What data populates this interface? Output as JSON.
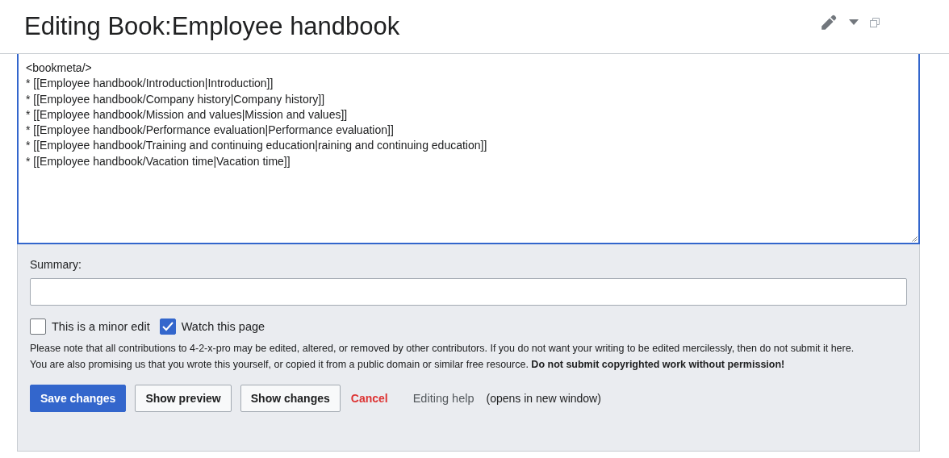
{
  "page_title": "Editing Book:Employee handbook",
  "editor": {
    "lines": [
      "<bookmeta/>",
      "* [[Employee handbook/Introduction|Introduction]]",
      "* [[Employee handbook/Company history|Company history]]",
      "* [[Employee handbook/Mission and values|Mission and values]]",
      "* [[Employee handbook/Performance evaluation|Performance evaluation]]",
      "* [[Employee handbook/Training and continuing education|raining and continuing education]]",
      "* [[Employee handbook/Vacation time|Vacation time]]"
    ]
  },
  "summary": {
    "label": "Summary:"
  },
  "checkboxes": [
    {
      "label": "This is a minor edit",
      "checked": false
    },
    {
      "label": "Watch this page",
      "checked": true
    }
  ],
  "notice": [
    "Please note that all contributions to 4-2-x-pro may be edited, altered, or removed by other contributors. If you do not want your writing to be edited mercilessly, then do not submit it here.",
    "You are also promising us that you wrote this yourself, or copied it from a public domain or similar free resource. **Do not submit copyrighted work without permission!**"
  ],
  "buttons": [
    {
      "label": "Save changes",
      "kind": "primary"
    },
    {
      "label": "Show preview",
      "kind": "normal"
    },
    {
      "label": "Show changes",
      "kind": "normal"
    },
    {
      "label": "Cancel",
      "kind": "destructive"
    }
  ],
  "help_link": "Editing help",
  "help_note": "(opens in new window)"
}
